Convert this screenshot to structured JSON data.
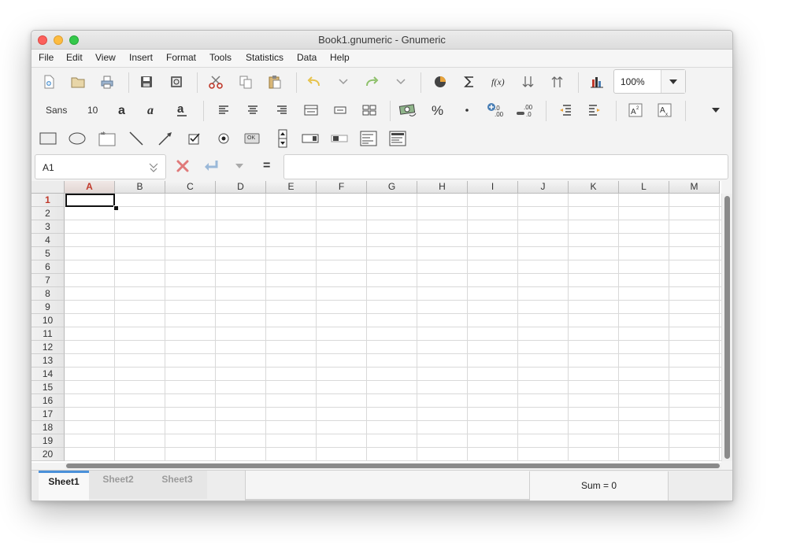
{
  "window": {
    "title": "Book1.gnumeric - Gnumeric"
  },
  "menu": [
    "File",
    "Edit",
    "View",
    "Insert",
    "Format",
    "Tools",
    "Statistics",
    "Data",
    "Help"
  ],
  "toolbar": {
    "zoom_value": "100%",
    "font_name": "Sans",
    "font_size": "10",
    "ok_label": "OK"
  },
  "formula_bar": {
    "cell_ref": "A1",
    "equals": "=",
    "content": ""
  },
  "grid": {
    "columns": [
      "A",
      "B",
      "C",
      "D",
      "E",
      "F",
      "G",
      "H",
      "I",
      "J",
      "K",
      "L",
      "M"
    ],
    "rows": [
      "1",
      "2",
      "3",
      "4",
      "5",
      "6",
      "7",
      "8",
      "9",
      "10",
      "11",
      "12",
      "13",
      "14",
      "15",
      "16",
      "17",
      "18",
      "19",
      "20"
    ],
    "selected_cell": "A1"
  },
  "sheets": [
    "Sheet1",
    "Sheet2",
    "Sheet3"
  ],
  "status": {
    "sum": "Sum = 0"
  },
  "colors": {
    "accent": "#4a90d9",
    "selected_header": "#c0392b"
  }
}
